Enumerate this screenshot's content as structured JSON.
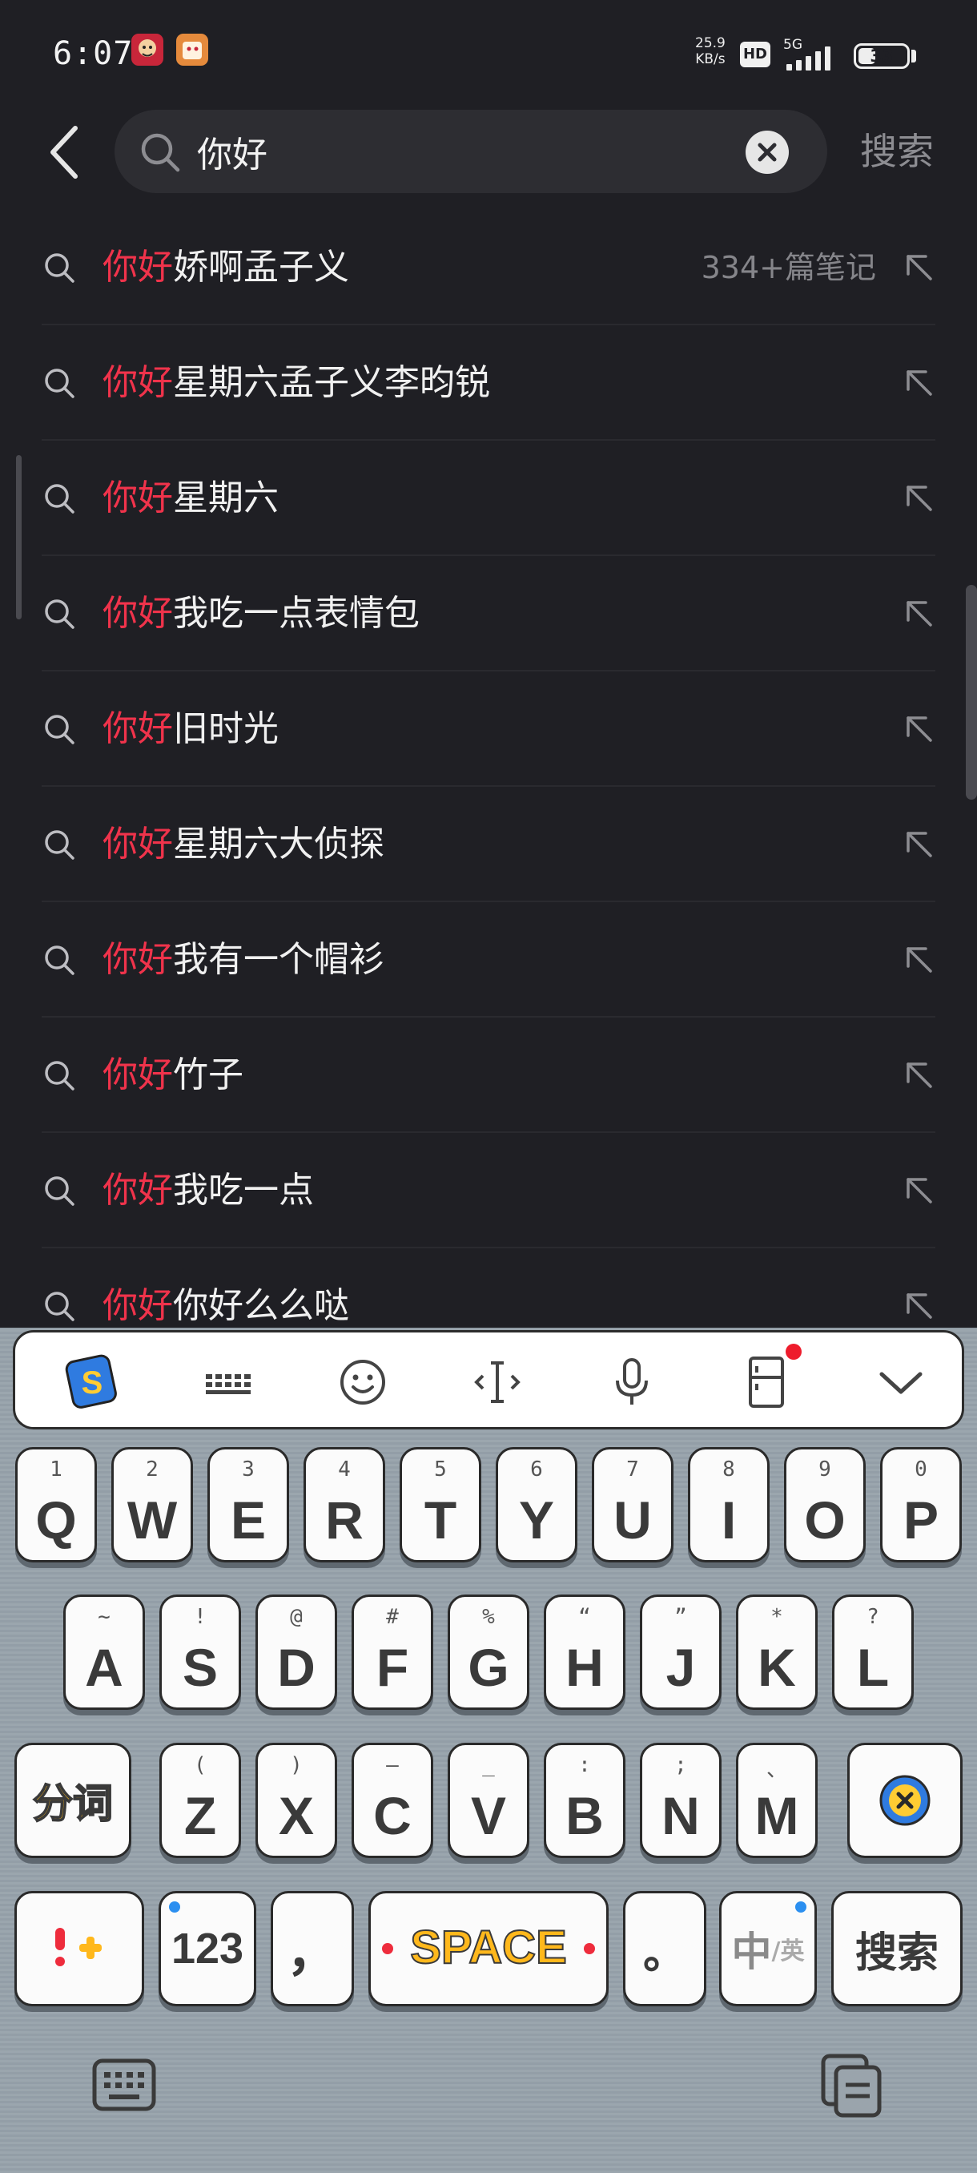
{
  "status_bar": {
    "time": "6:07",
    "net_speed_value": "25.9",
    "net_speed_unit": "KB/s",
    "hd_badge": "HD",
    "network": "5G",
    "battery": "33"
  },
  "search": {
    "query": "你好",
    "button_label": "搜索"
  },
  "suggestions": [
    {
      "highlight": "你好",
      "rest": "娇啊孟子义",
      "count": "334+篇笔记"
    },
    {
      "highlight": "你好",
      "rest": "星期六孟子义李昀锐",
      "count": ""
    },
    {
      "highlight": "你好",
      "rest": "星期六",
      "count": ""
    },
    {
      "highlight": "你好",
      "rest": "我吃一点表情包",
      "count": ""
    },
    {
      "highlight": "你好",
      "rest": "旧时光",
      "count": ""
    },
    {
      "highlight": "你好",
      "rest": "星期六大侦探",
      "count": ""
    },
    {
      "highlight": "你好",
      "rest": "我有一个帽衫",
      "count": ""
    },
    {
      "highlight": "你好",
      "rest": "竹子",
      "count": ""
    },
    {
      "highlight": "你好",
      "rest": "我吃一点",
      "count": ""
    },
    {
      "highlight": "你好",
      "rest": "你好么么哒",
      "count": ""
    }
  ],
  "keyboard": {
    "toolbar_badge_letter": "S",
    "row1": [
      {
        "main": "Q",
        "sub": "1"
      },
      {
        "main": "W",
        "sub": "2"
      },
      {
        "main": "E",
        "sub": "3"
      },
      {
        "main": "R",
        "sub": "4"
      },
      {
        "main": "T",
        "sub": "5"
      },
      {
        "main": "Y",
        "sub": "6"
      },
      {
        "main": "U",
        "sub": "7"
      },
      {
        "main": "I",
        "sub": "8"
      },
      {
        "main": "O",
        "sub": "9"
      },
      {
        "main": "P",
        "sub": "0"
      }
    ],
    "row2": [
      {
        "main": "A",
        "sub": "~"
      },
      {
        "main": "S",
        "sub": "!"
      },
      {
        "main": "D",
        "sub": "@"
      },
      {
        "main": "F",
        "sub": "#"
      },
      {
        "main": "G",
        "sub": "%"
      },
      {
        "main": "H",
        "sub": "“"
      },
      {
        "main": "J",
        "sub": "”"
      },
      {
        "main": "K",
        "sub": "*"
      },
      {
        "main": "L",
        "sub": "?"
      }
    ],
    "row3": [
      {
        "main": "Z",
        "sub": "("
      },
      {
        "main": "X",
        "sub": ")"
      },
      {
        "main": "C",
        "sub": "—"
      },
      {
        "main": "V",
        "sub": "_"
      },
      {
        "main": "B",
        "sub": ":"
      },
      {
        "main": "N",
        "sub": ";"
      },
      {
        "main": "M",
        "sub": "、"
      }
    ],
    "segment_label": "分词",
    "numbers_label": "123",
    "comma_label": "，",
    "space_label": "SPACE",
    "period_label": "。",
    "lang_label_main": "中",
    "lang_label_sub": "/英",
    "enter_label": "搜索"
  },
  "colors": {
    "background": "#1f1f24",
    "highlight": "#f0334b",
    "keyboard_bg": "#9aa4ac"
  }
}
